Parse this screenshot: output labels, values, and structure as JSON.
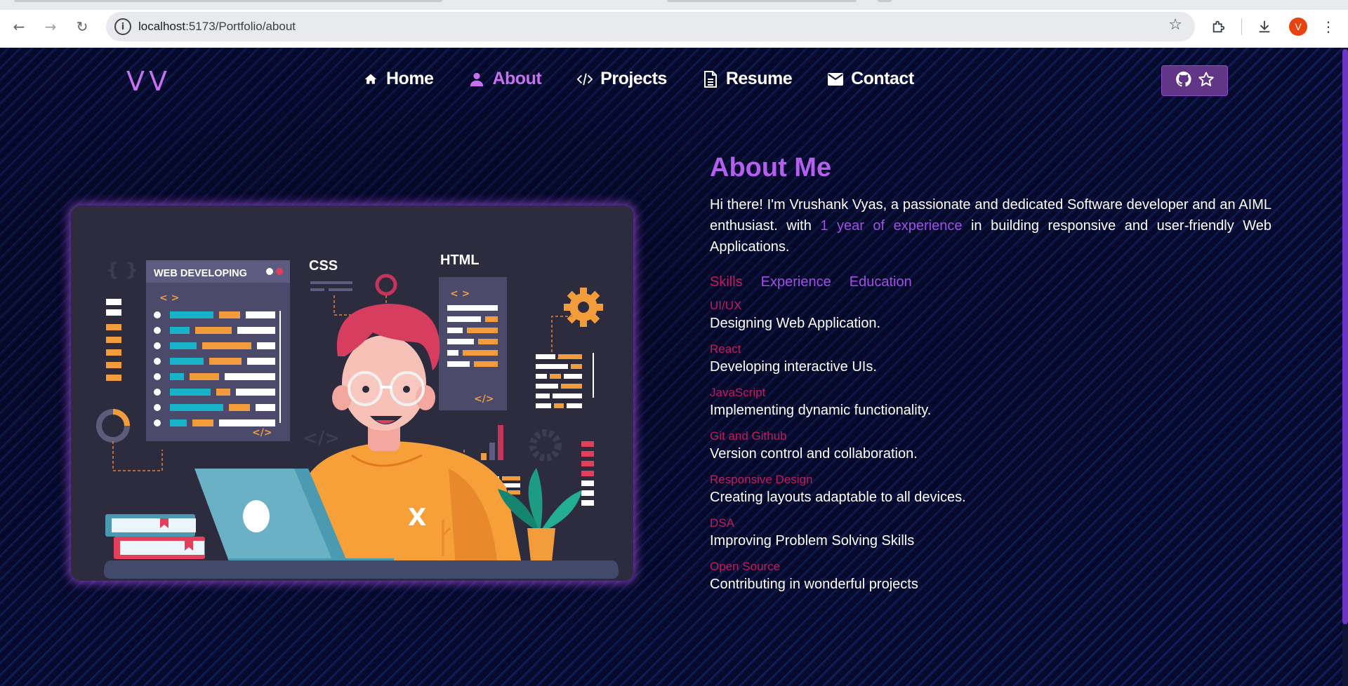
{
  "browser": {
    "url_host": "localhost",
    "url_path": ":5173/Portfolio/about",
    "profile_initial": "V"
  },
  "site": {
    "logo": "VV",
    "nav": [
      {
        "label": "Home",
        "icon": "home-icon"
      },
      {
        "label": "About",
        "icon": "user-icon",
        "active": true
      },
      {
        "label": "Projects",
        "icon": "code-icon"
      },
      {
        "label": "Resume",
        "icon": "document-icon"
      },
      {
        "label": "Contact",
        "icon": "mail-icon"
      }
    ],
    "github_button_icons": [
      "github-icon",
      "star-icon"
    ]
  },
  "illustration": {
    "panel_title": "WEB DEVELOPING",
    "css_label": "CSS",
    "html_label": "HTML",
    "code_open": "< >",
    "code_close": "</>",
    "shirt_mark": "X"
  },
  "about": {
    "title": "About Me",
    "intro_before": "Hi there! I'm Vrushank Vyas, a passionate and dedicated Software developer and an AIML enthusiast. with ",
    "intro_highlight": "1 year of experience",
    "intro_after": " in building responsive and user-friendly Web Applications.",
    "tabs": [
      {
        "label": "Skills",
        "active": true
      },
      {
        "label": "Experience"
      },
      {
        "label": "Education"
      }
    ],
    "skills": [
      {
        "name": "UI/UX",
        "desc": "Designing Web Application."
      },
      {
        "name": "React",
        "desc": "Developing interactive UIs."
      },
      {
        "name": "JavaScript",
        "desc": "Implementing dynamic functionality."
      },
      {
        "name": "Git and Github",
        "desc": "Version control and collaboration."
      },
      {
        "name": "Responsive Design",
        "desc": "Creating layouts adaptable to all devices."
      },
      {
        "name": "DSA",
        "desc": "Improving Problem Solving Skills"
      },
      {
        "name": "Open Source",
        "desc": "Contributing in wonderful projects"
      }
    ]
  },
  "colors": {
    "accent": "#c770f0",
    "accent_dark": "#a24fe5",
    "skill_name": "#c21c5f",
    "github_btn": "#623686"
  }
}
